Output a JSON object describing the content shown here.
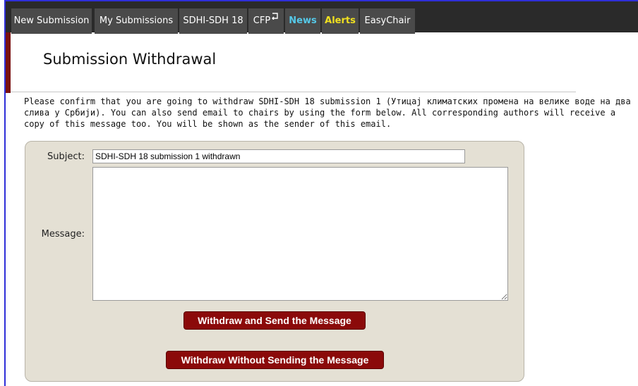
{
  "nav": {
    "items": [
      {
        "label": "New Submission"
      },
      {
        "label": "My Submissions"
      },
      {
        "label": "SDHI-SDH 18"
      },
      {
        "label": "CFP"
      },
      {
        "label": "News"
      },
      {
        "label": "Alerts"
      },
      {
        "label": "EasyChair"
      }
    ]
  },
  "header": {
    "title": "Submission Withdrawal"
  },
  "intro": {
    "text": "Please confirm that you are going to withdraw SDHI-SDH 18 submission 1 (Утицај климатских промена на велике воде на два слива у Србији). You can also send email to chairs by using the form below. All corresponding authors will receive a copy of this message too. You will be shown as the sender of this email."
  },
  "form": {
    "subject_label": "Subject:",
    "subject_value": "SDHI-SDH 18 submission 1 withdrawn",
    "message_label": "Message:",
    "message_value": "",
    "withdraw_send_label": "Withdraw and Send the Message",
    "withdraw_nosend_label": "Withdraw Without Sending the Message"
  },
  "colors": {
    "navbar_bg": "#2a2a2a",
    "nav_item_bg": "#4a4a4a",
    "news": "#55c8e8",
    "alerts": "#f0e020",
    "button_bg": "#8b0a0a",
    "panel_bg": "#e4e0d4"
  },
  "icons": {
    "cfp": "return-arrow-icon"
  }
}
